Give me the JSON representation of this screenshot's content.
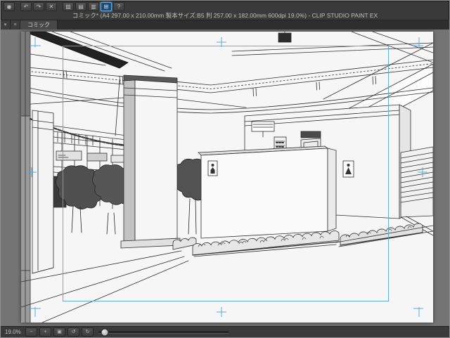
{
  "window": {
    "title": "コミック* (A4 297.00 x 210.00mm 製本サイズ:B5 判 257.00 x 182.00mm 600dpi 19.0%) - CLIP STUDIO PAINT EX"
  },
  "command_bar": {
    "icons": [
      {
        "name": "clip-studio-home-icon",
        "glyph": "◉",
        "active": false
      },
      {
        "name": "undo-icon",
        "glyph": "↶",
        "active": false
      },
      {
        "name": "redo-icon",
        "glyph": "↷",
        "active": false
      },
      {
        "name": "delete-icon",
        "glyph": "✕",
        "active": false
      },
      {
        "name": "fill-icon",
        "glyph": "▨",
        "active": false
      },
      {
        "name": "snap-ruler-icon",
        "glyph": "▤",
        "active": false
      },
      {
        "name": "snap-special-ruler-icon",
        "glyph": "▥",
        "active": false
      },
      {
        "name": "snap-grid-icon",
        "glyph": "⊞",
        "active": true
      },
      {
        "name": "help-icon",
        "glyph": "?",
        "active": false
      }
    ]
  },
  "tab_bar": {
    "menu_icon": "▾",
    "list_icon": "≡",
    "tabs": [
      {
        "label": "コミック",
        "active": true
      }
    ]
  },
  "status_bar": {
    "zoom_value": "19.0%",
    "zoom_out_icon": "−",
    "zoom_in_icon": "+",
    "fit_screen_icon": "▣",
    "rotate_left_icon": "↺",
    "rotate_right_icon": "↻"
  },
  "canvas": {
    "guide_color": "#5aa7dc",
    "active_icon_glow": "#4aa0e8",
    "content_description": "perspective line-art background: ceiling pipes, concrete pillar, restroom building, hedges and trees"
  }
}
